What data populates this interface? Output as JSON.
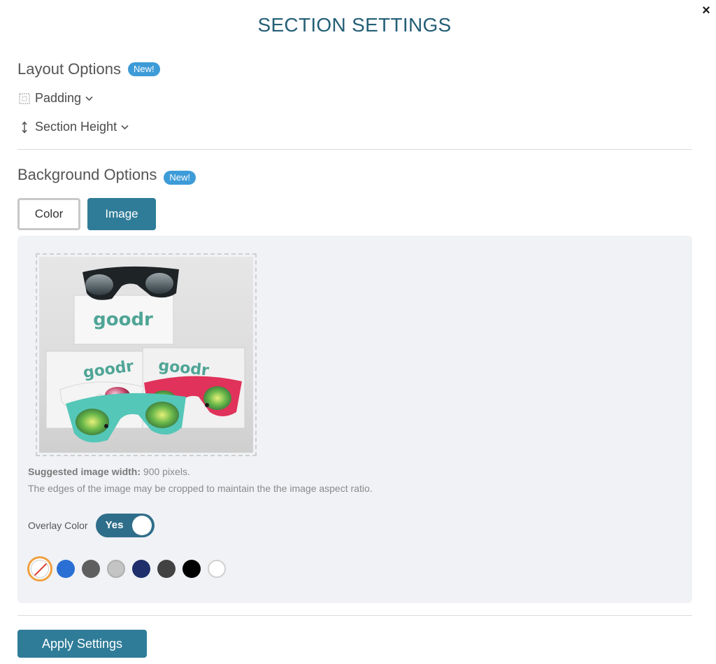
{
  "dialog": {
    "title": "SECTION SETTINGS",
    "close_glyph": "×"
  },
  "layout": {
    "heading": "Layout Options",
    "badge": "New!",
    "options": [
      {
        "label": "Padding",
        "icon": "padding-icon"
      },
      {
        "label": "Section Height",
        "icon": "height-arrows-icon"
      }
    ]
  },
  "background": {
    "heading": "Background Options",
    "badge": "New!",
    "tabs": [
      {
        "label": "Color",
        "active": false
      },
      {
        "label": "Image",
        "active": true
      }
    ],
    "image": {
      "brand_text": "goodr"
    },
    "suggested_label": "Suggested image width:",
    "suggested_value": "900 pixels.",
    "crop_note": "The edges of the image may be cropped to maintain the the image aspect ratio.",
    "overlay_label": "Overlay Color",
    "overlay_toggle": "Yes",
    "swatches": [
      "none",
      "#2a6fd4",
      "#5f5f5f",
      "#c4c4c4",
      "#1e2f6b",
      "#424242",
      "#000000",
      "#ffffff"
    ]
  },
  "footer": {
    "apply_label": "Apply Settings"
  },
  "colors": {
    "accent": "#2f7c98",
    "title": "#245f77",
    "badge": "#3d9bd8",
    "selected_ring": "#f0a040"
  }
}
